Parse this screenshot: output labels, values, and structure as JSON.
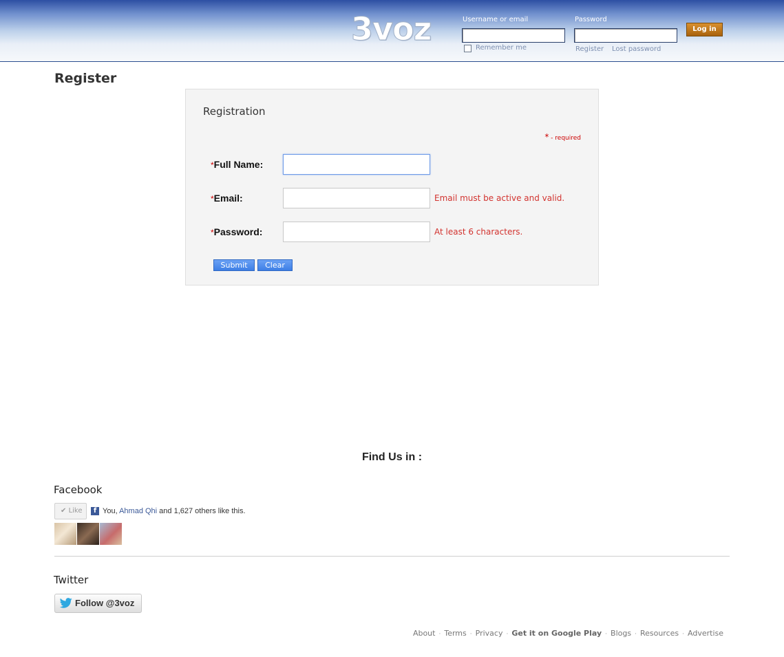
{
  "header": {
    "logo": "3voz",
    "username_label": "Username or email",
    "password_label": "Password",
    "login_button": "Log in",
    "remember_me": "Remember me",
    "register_link": "Register",
    "lost_password_link": "Lost password"
  },
  "page": {
    "title": "Register"
  },
  "form": {
    "title": "Registration",
    "required_star": "*",
    "required_note": " - required",
    "fields": [
      {
        "asterisk": "*",
        "label": "Full Name:",
        "value": "",
        "hint": ""
      },
      {
        "asterisk": "*",
        "label": "Email:",
        "value": "",
        "hint": "Email must be active and valid."
      },
      {
        "asterisk": "*",
        "label": "Password:",
        "value": "",
        "hint": "At least 6 characters."
      }
    ],
    "submit_button": "Submit",
    "clear_button": "Clear"
  },
  "footer": {
    "find_us": "Find Us in :",
    "facebook": {
      "title": "Facebook",
      "like_button": "Like",
      "text_prefix": "You, ",
      "friend_name": "Ahmad Qhi",
      "text_suffix": " and 1,627 others like this."
    },
    "twitter": {
      "title": "Twitter",
      "follow_button": "Follow @3voz"
    },
    "links": [
      "About",
      "Terms",
      "Privacy",
      "Get it on Google Play",
      "Blogs",
      "Resources",
      "Advertise"
    ]
  },
  "colors": {
    "header_top": "#2d4fa3",
    "error_text": "#d2332f",
    "required": "#cc0000",
    "button_blue": "#3d7fe6",
    "login_orange": "#c07a1e"
  }
}
